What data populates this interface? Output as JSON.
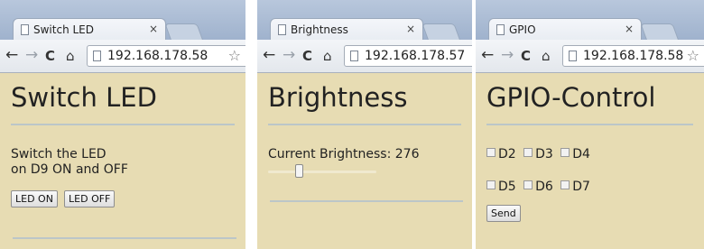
{
  "panels": [
    {
      "tab_title": "Switch LED",
      "tab_close": "×",
      "url": "192.168.178.58",
      "heading": "Switch LED",
      "text_lines": [
        "Switch the LED",
        "on D9 ON and OFF"
      ],
      "buttons": [
        "LED ON",
        "LED OFF"
      ]
    },
    {
      "tab_title": "Brightness",
      "tab_close": "×",
      "url": "192.168.178.57",
      "heading": "Brightness",
      "brightness_label": "Current Brightness: 276",
      "brightness_value": 276,
      "slider_fraction": 0.27
    },
    {
      "tab_title": "GPIO",
      "tab_close": "×",
      "url": "192.168.178.58",
      "heading": "GPIO-Control",
      "checkbox_rows": [
        [
          "D2",
          "D3",
          "D4"
        ],
        [
          "D5",
          "D6",
          "D7"
        ]
      ],
      "send_label": "Send"
    }
  ],
  "icons": {
    "back": "←",
    "forward": "→",
    "reload": "C",
    "home": "⌂",
    "star": "☆"
  },
  "colors": {
    "page_bg": "#e7dcb3",
    "chrome_bg": "#b8c7dc",
    "rule": "#bcc6c8"
  }
}
